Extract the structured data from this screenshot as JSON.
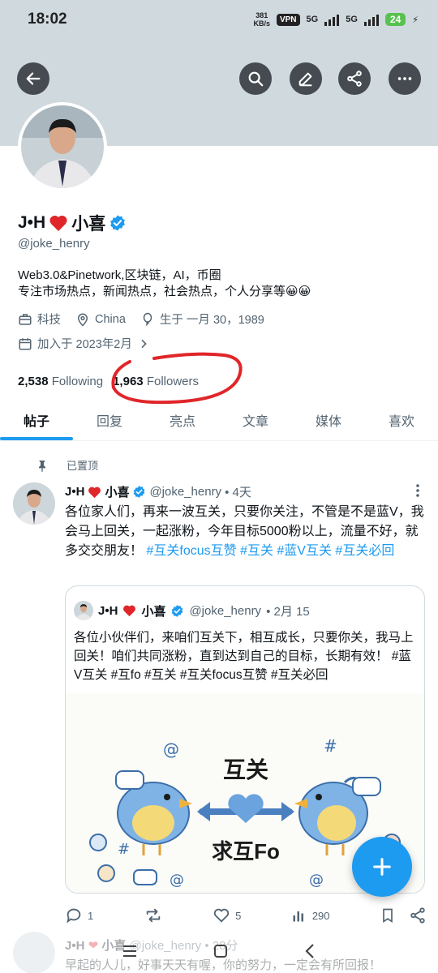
{
  "status": {
    "time": "18:02",
    "speed_value": "381",
    "speed_unit": "KB/s",
    "vpn": "VPN",
    "net1": "5G",
    "net2": "5G",
    "battery": "24"
  },
  "profile": {
    "name": "J•H",
    "name_suffix": "小喜",
    "handle": "@joke_henry",
    "bio_line1": "Web3.0&Pinetwork,区块链，AI，币圈",
    "bio_line2": "专注市场热点，新闻热点，社会热点，个人分享等😀😀",
    "category": "科技",
    "location": "China",
    "birthday": "生于 一月 30，1989",
    "joined": "加入于 2023年2月",
    "following_count": "2,538",
    "following_label": "Following",
    "followers_count": "1,963",
    "followers_label": "Followers"
  },
  "tabs": [
    "帖子",
    "回复",
    "亮点",
    "文章",
    "媒体",
    "喜欢"
  ],
  "pinned_label": "已置顶",
  "tweet": {
    "name": "J•H",
    "name_suffix": "小喜",
    "handle": "@joke_henry",
    "time": "• 4天",
    "text": "各位家人们，再来一波互关，只要你关注，不管是不是蓝V，我会马上回关，一起涨粉，今年目标5000粉以上，流量不好，就多交交朋友！",
    "hashtags": "#互关focus互赞 #互关 #蓝V互关 #互关必回",
    "replies": "1",
    "likes": "5",
    "views": "290"
  },
  "quote": {
    "name": "J•H",
    "name_suffix": "小喜",
    "handle": "@joke_henry",
    "time": "• 2月 15",
    "text": "各位小伙伴们，来咱们互关下，相互成长，只要你关，我马上回关！咱们共同涨粉，直到达到自己的目标，长期有效！ #蓝V互关 #互fo #互关 #互关focus互赞 #互关必回",
    "image_text_top": "互关",
    "image_text_bottom": "求互Fo"
  },
  "next_tweet": {
    "name": "J•H",
    "name_suffix": "小喜",
    "handle": "@joke_henry",
    "time": "• 28分",
    "text": "早起的人儿，好事天天有喔，你的努力，一定会有所回报！"
  },
  "colors": {
    "accent": "#1d9bf0",
    "annotation": "#e0262a",
    "heart": "#e0262a"
  }
}
